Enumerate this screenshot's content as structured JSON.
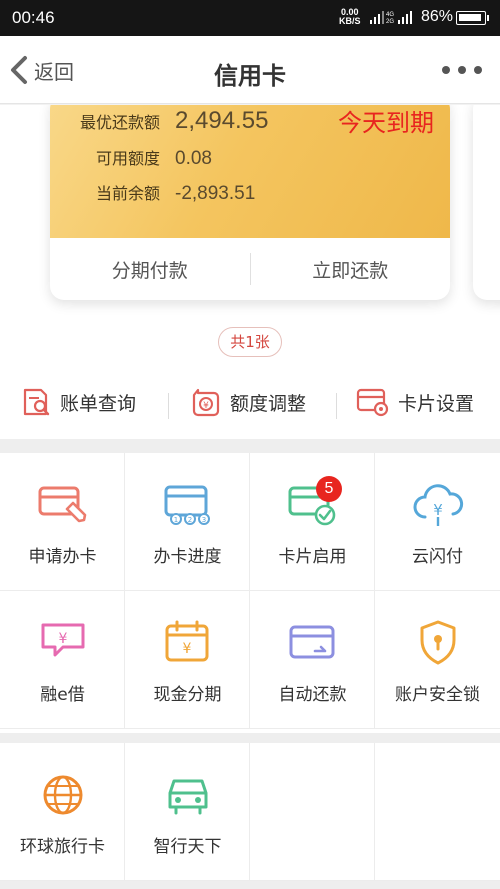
{
  "status_bar": {
    "time": "00:46",
    "net_speed": "0.00",
    "net_unit": "KB/S",
    "battery": "86%",
    "battery_level": 0.86
  },
  "nav": {
    "back_label": "返回",
    "title": "信用卡"
  },
  "card": {
    "min_payment_label": "最优还款额",
    "min_payment_value": "2,494.55",
    "available_label": "可用额度",
    "available_value": "0.08",
    "balance_label": "当前余额",
    "balance_value": "-2,893.51",
    "due_tag": "今天到期",
    "installment_label": "分期付款",
    "repay_label": "立即还款"
  },
  "card_count": "共1张",
  "quick_actions": [
    {
      "label": "账单查询"
    },
    {
      "label": "额度调整"
    },
    {
      "label": "卡片设置"
    }
  ],
  "services": [
    {
      "label": "申请办卡",
      "icon": "card-apply-icon"
    },
    {
      "label": "办卡进度",
      "icon": "card-progress-icon"
    },
    {
      "label": "卡片启用",
      "icon": "card-activate-icon",
      "badge": "5"
    },
    {
      "label": "云闪付",
      "icon": "cloud-pay-icon"
    },
    {
      "label": "融e借",
      "icon": "loan-icon"
    },
    {
      "label": "现金分期",
      "icon": "cash-installment-icon"
    },
    {
      "label": "自动还款",
      "icon": "auto-repay-icon"
    },
    {
      "label": "账户安全锁",
      "icon": "security-lock-icon"
    },
    {
      "label": "环球旅行卡",
      "icon": "globe-icon"
    },
    {
      "label": "智行天下",
      "icon": "car-icon"
    }
  ],
  "colors": {
    "accent_red": "#e8251f",
    "card_gold": "#f4c55f"
  }
}
